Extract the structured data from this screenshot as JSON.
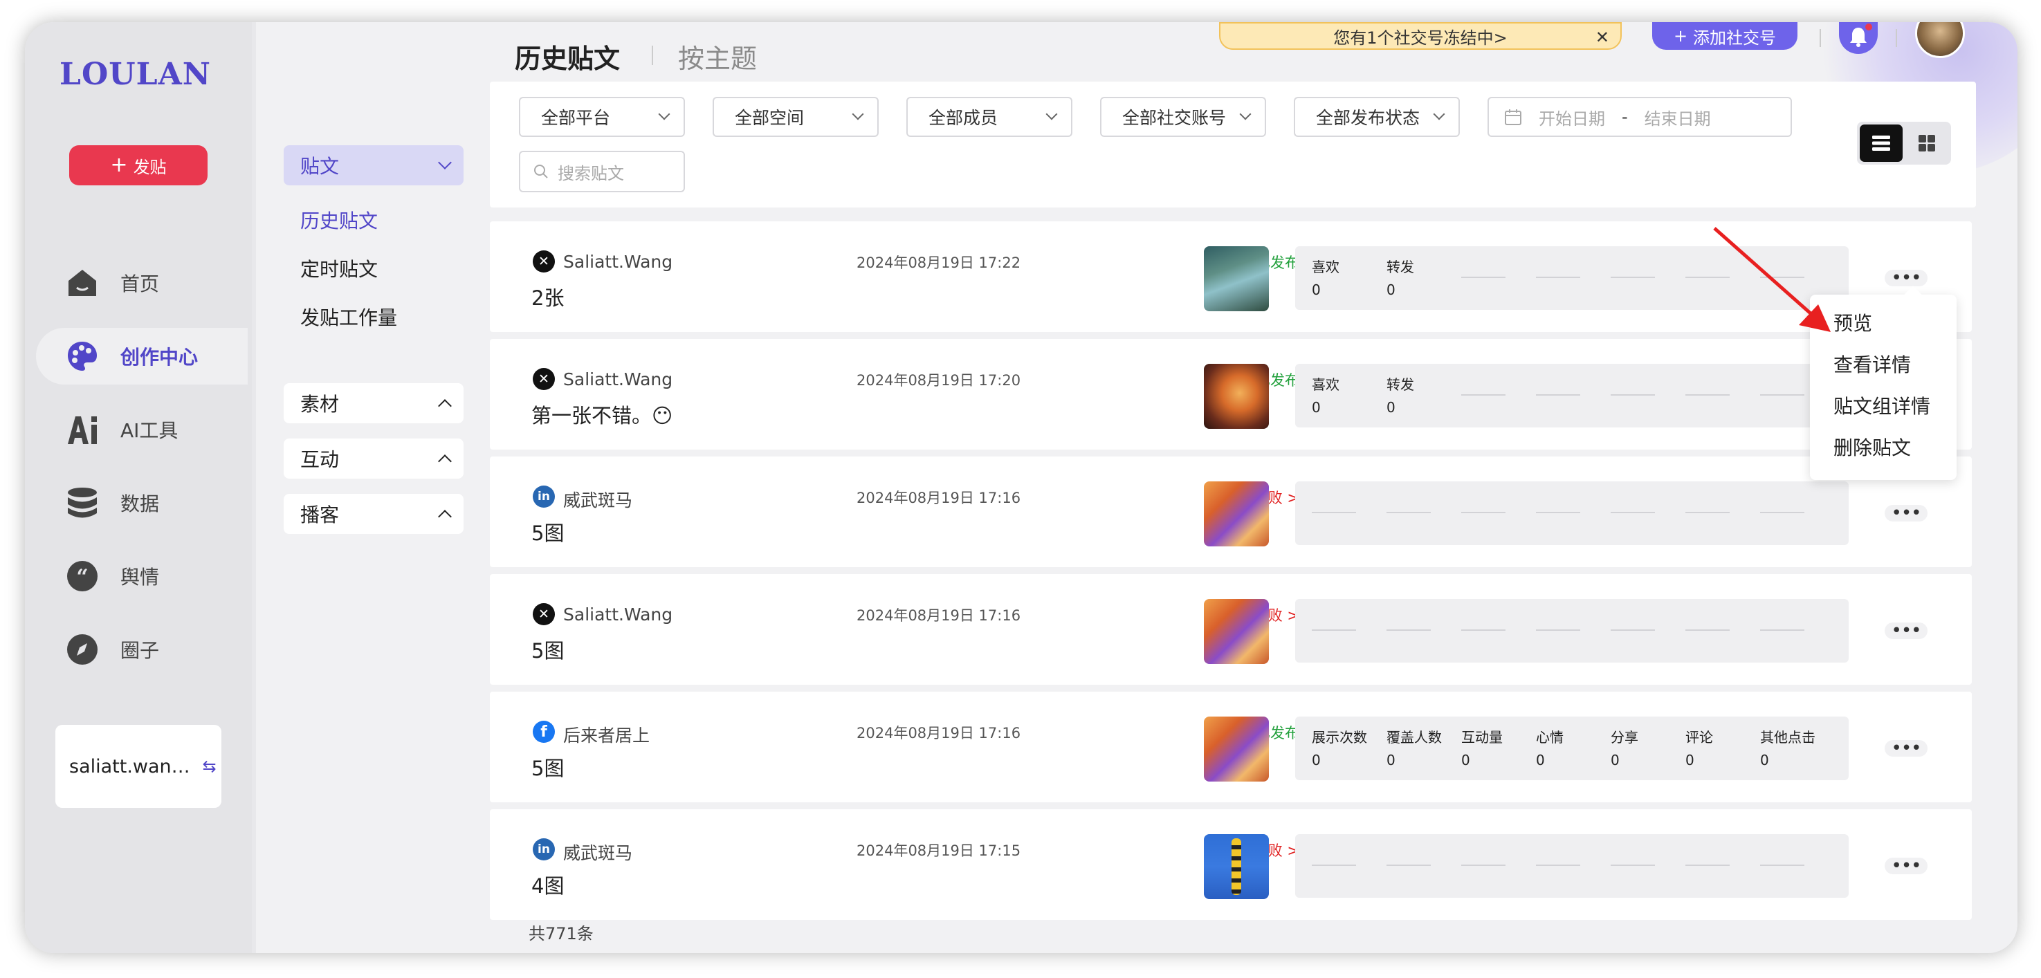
{
  "app": {
    "logo": "LOULAN",
    "post_button": "发贴"
  },
  "nav": [
    {
      "label": "首页",
      "icon": "home-icon"
    },
    {
      "label": "创作中心",
      "icon": "palette-icon",
      "active": true
    },
    {
      "label": "AI工具",
      "icon": "ai-icon"
    },
    {
      "label": "数据",
      "icon": "database-icon"
    },
    {
      "label": "舆情",
      "icon": "quote-icon"
    },
    {
      "label": "圈子",
      "icon": "compass-icon"
    }
  ],
  "user": {
    "name": "saliatt.wan…",
    "swap_icon": "swap-icon"
  },
  "subnav": {
    "posts_header": "贴文",
    "links": [
      "历史贴文",
      "定时贴文",
      "发贴工作量"
    ],
    "groups": [
      "素材",
      "互动",
      "播客"
    ]
  },
  "header": {
    "tabs": [
      "历史贴文",
      "按主题"
    ],
    "notice": "您有1个社交号冻结中>",
    "add_account": "添加社交号"
  },
  "filters": {
    "platform": "全部平台",
    "space": "全部空间",
    "member": "全部成员",
    "account": "全部社交账号",
    "status": "全部发布状态",
    "start_date_placeholder": "开始日期",
    "date_sep": "-",
    "end_date_placeholder": "结束日期",
    "search_placeholder": "搜索贴文"
  },
  "posts": [
    {
      "platform": "x",
      "author": "Saliatt.Wang",
      "content": "2张",
      "time": "2024年08月19日 17:22",
      "status": "已发布",
      "status_type": "ok",
      "thumb": "forest",
      "stats": [
        {
          "label": "喜欢",
          "value": "0"
        },
        {
          "label": "转发",
          "value": "0"
        }
      ]
    },
    {
      "platform": "x",
      "author": "Saliatt.Wang",
      "content": "第一张不错。😶",
      "time": "2024年08月19日 17:20",
      "status": "已发布",
      "status_type": "ok",
      "thumb": "moon",
      "stats": [
        {
          "label": "喜欢",
          "value": "0"
        },
        {
          "label": "转发",
          "value": "0"
        }
      ]
    },
    {
      "platform": "in",
      "author": "威武斑马",
      "content": "5图",
      "time": "2024年08月19日 17:16",
      "status": "发布失败 >",
      "status_type": "fail",
      "thumb": "leaf",
      "stats": []
    },
    {
      "platform": "x",
      "author": "Saliatt.Wang",
      "content": "5图",
      "time": "2024年08月19日 17:16",
      "status": "发布失败 >",
      "status_type": "fail",
      "thumb": "leaf",
      "stats": []
    },
    {
      "platform": "fb",
      "author": "后来者居上",
      "content": "5图",
      "time": "2024年08月19日 17:16",
      "status": "已发布",
      "status_type": "ok",
      "thumb": "leaf",
      "stats": [
        {
          "label": "展示次数",
          "value": "0"
        },
        {
          "label": "覆盖人数",
          "value": "0"
        },
        {
          "label": "互动量",
          "value": "0"
        },
        {
          "label": "心情",
          "value": "0"
        },
        {
          "label": "分享",
          "value": "0"
        },
        {
          "label": "评论",
          "value": "0"
        },
        {
          "label": "其他点击",
          "value": "0"
        }
      ]
    },
    {
      "platform": "in",
      "author": "威武斑马",
      "content": "4图",
      "time": "2024年08月19日 17:15",
      "status": "发布失败 >",
      "status_type": "fail",
      "thumb": "bee",
      "stats": []
    }
  ],
  "context_menu": [
    "预览",
    "查看详情",
    "贴文组详情",
    "删除贴文"
  ],
  "total": "共771条",
  "colors": {
    "accent": "#5146c8",
    "post_button": "#e9384f",
    "published": "#22a03c",
    "failed": "#e02020",
    "arrow": "#e82020"
  }
}
